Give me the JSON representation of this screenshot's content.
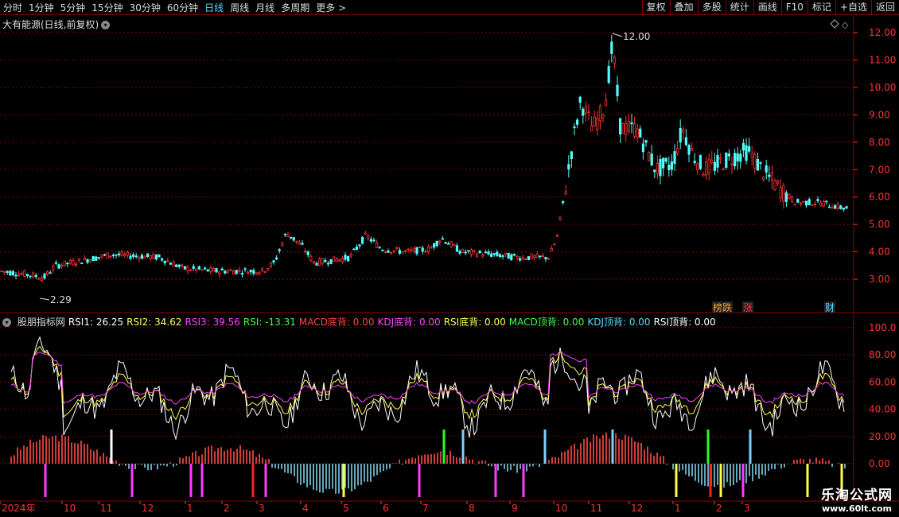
{
  "toolbar": {
    "periods": [
      "分时",
      "1分钟",
      "5分钟",
      "15分钟",
      "30分钟",
      "60分钟",
      "日线",
      "周线",
      "月线",
      "多周期",
      "更多 >"
    ],
    "active": "日线",
    "right_buttons": [
      "复权",
      "叠加",
      "多股",
      "统计",
      "画线",
      "F10",
      "标记",
      "+自选",
      "返回"
    ]
  },
  "stock_title": "大有能源(日线,前复权)",
  "price_axis": [
    "12.00",
    "11.00",
    "10.00",
    "9.00",
    "8.00",
    "7.00",
    "6.00",
    "5.00",
    "4.00",
    "3.00"
  ],
  "annotations": {
    "high": "12.00",
    "low": "2.29"
  },
  "badges": [
    "榜跌",
    "涨",
    "财"
  ],
  "indicator": {
    "name": "股朋指标网",
    "fields": [
      {
        "text": "RSI1: 26.25",
        "color": "#ffffff"
      },
      {
        "text": "RSI2: 34.62",
        "color": "#ffff55"
      },
      {
        "text": "RSI3: 39.56",
        "color": "#ff44ff"
      },
      {
        "text": "RSI: -13.31",
        "color": "#44ff44"
      },
      {
        "text": "MACD底背: 0.00",
        "color": "#ff4444"
      },
      {
        "text": "KDJ底背: 0.00",
        "color": "#ff44ff"
      },
      {
        "text": "RSI底背: 0.00",
        "color": "#ffff55"
      },
      {
        "text": "MACD顶背: 0.00",
        "color": "#44ff44"
      },
      {
        "text": "KDJ顶背: 0.00",
        "color": "#5ad8ff"
      },
      {
        "text": "RSI顶背: 0.00",
        "color": "#ffffff"
      }
    ]
  },
  "indicator_axis": [
    "100.0",
    "80.00",
    "60.00",
    "40.00",
    "20.00",
    "0.00"
  ],
  "dates": [
    "2024年",
    "10",
    "11",
    "12",
    "1",
    "2",
    "3",
    "4",
    "5",
    "6",
    "7",
    "8",
    "9",
    "10",
    "11",
    "12",
    "1",
    "2",
    "3"
  ],
  "watermark": {
    "line1": "乐淘公式网",
    "line2": "www.60lt.com"
  }
}
